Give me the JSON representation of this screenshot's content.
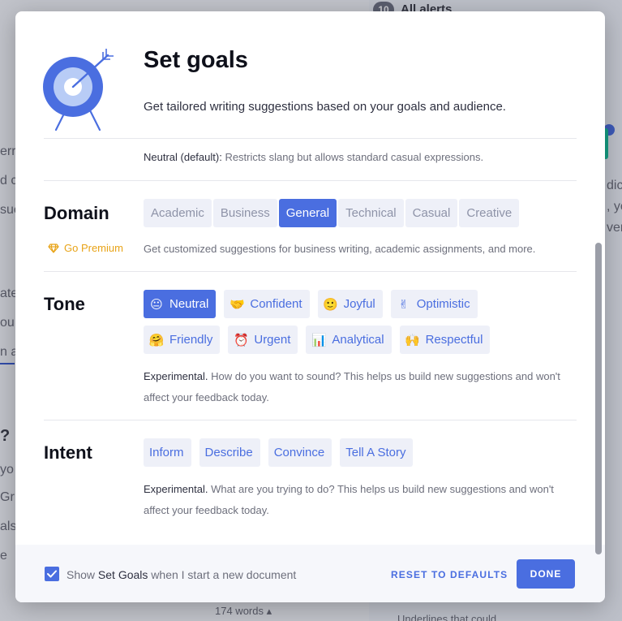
{
  "background": {
    "alerts_count": "10",
    "alerts_label": "All alerts",
    "fragments_left": [
      "erro",
      "d c",
      "sue",
      "ate",
      "ou",
      "n a",
      "?",
      "yo",
      "Gr",
      "als",
      "e"
    ],
    "fragments_right": [
      "dict",
      ", yo",
      "ver"
    ],
    "word_count": "174 words ▴",
    "bottom_text": "Underlines that could ..."
  },
  "modal": {
    "title": "Set goals",
    "subtitle": "Get tailored writing suggestions based on your goals and audience.",
    "formality_info": {
      "label": "Neutral (default):",
      "text": " Restricts slang but allows standard casual expressions."
    },
    "domain": {
      "title": "Domain",
      "premium_label": "Go Premium",
      "options": [
        "Academic",
        "Business",
        "General",
        "Technical",
        "Casual",
        "Creative"
      ],
      "selected": "General",
      "info": "Get customized suggestions for business writing, academic assignments, and more."
    },
    "tone": {
      "title": "Tone",
      "options_row1": [
        {
          "label": "Neutral",
          "icon": "neutral-face-icon",
          "emoji": "😐"
        },
        {
          "label": "Confident",
          "icon": "handshake-icon",
          "emoji": "🤝"
        },
        {
          "label": "Joyful",
          "icon": "smiling-face-icon",
          "emoji": "🙂"
        },
        {
          "label": "Optimistic",
          "icon": "victory-hand-icon",
          "emoji": "✌"
        }
      ],
      "options_row2": [
        {
          "label": "Friendly",
          "icon": "hugging-face-icon",
          "emoji": "🤗"
        },
        {
          "label": "Urgent",
          "icon": "alarm-clock-icon",
          "emoji": "⏰"
        },
        {
          "label": "Analytical",
          "icon": "bar-chart-icon",
          "emoji": "📊"
        },
        {
          "label": "Respectful",
          "icon": "raised-hands-icon",
          "emoji": "🙌"
        }
      ],
      "selected": "Neutral",
      "info_label": "Experimental.",
      "info_text": " How do you want to sound? This helps us build new suggestions and won't affect your feedback today."
    },
    "intent": {
      "title": "Intent",
      "options": [
        "Inform",
        "Describe",
        "Convince",
        "Tell A Story"
      ],
      "info_label": "Experimental.",
      "info_text": " What are you trying to do? This helps us build new suggestions and won't affect your feedback today."
    },
    "footer": {
      "checkbox_checked": true,
      "checkbox_prefix": "Show ",
      "checkbox_strong": "Set Goals",
      "checkbox_suffix": " when I start a new document",
      "reset_label": "RESET TO DEFAULTS",
      "done_label": "DONE"
    }
  },
  "colors": {
    "accent": "#4a6ee0",
    "chip_bg": "#eef0f8",
    "premium": "#e8a317"
  }
}
